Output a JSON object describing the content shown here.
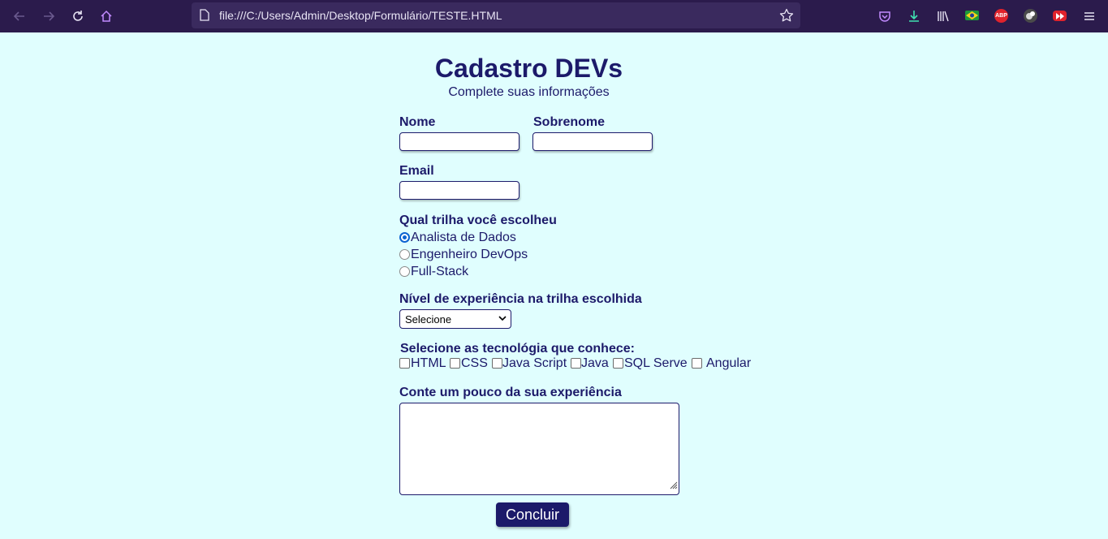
{
  "browser": {
    "url": "file:///C:/Users/Admin/Desktop/Formulário/TESTE.HTML",
    "extensions": {
      "abp": "ABP"
    }
  },
  "form": {
    "title": "Cadastro DEVs",
    "subtitle": "Complete suas informações",
    "nome_label": "Nome",
    "sobrenome_label": "Sobrenome",
    "email_label": "Email",
    "trilha_label": "Qual trilha você escolheu",
    "trilhas": [
      "Analista de Dados",
      "Engenheiro DevOps",
      "Full-Stack"
    ],
    "trilha_selected": "Analista de Dados",
    "nivel_label": "Nível de experiência na trilha escolhida",
    "nivel_value": "Selecione",
    "tec_label": "Selecione as tecnológia que conhece:",
    "tecnologias": [
      "HTML",
      "CSS",
      "Java Script",
      "Java",
      "SQL Serve",
      "Angular"
    ],
    "experiencia_label": "Conte um pouco da sua experiência",
    "submit_label": "Concluir"
  },
  "colors": {
    "primary": "#1c1a6a",
    "background": "#e0fefe",
    "toolbar": "#2b1b4c"
  }
}
